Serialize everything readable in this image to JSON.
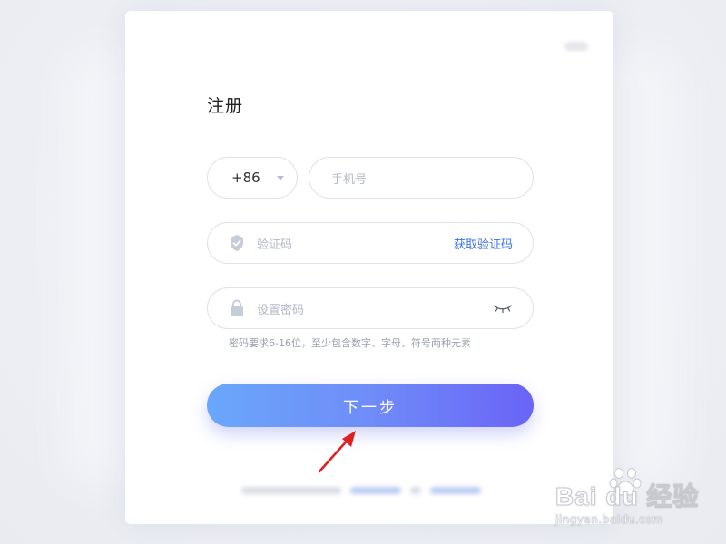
{
  "form": {
    "title": "注册",
    "country_code": "+86",
    "phone_placeholder": "手机号",
    "code_placeholder": "验证码",
    "get_code_label": "获取验证码",
    "password_placeholder": "设置密码",
    "password_hint": "密码要求6-16位，至少包含数字、字母、符号两种元素",
    "next_button_label": "下一步"
  },
  "icons": {
    "caret": "chevron-down-icon",
    "code": "shield-check-icon",
    "password": "lock-icon",
    "visibility": "eye-closed-icon",
    "annotation": "red-arrow-icon"
  },
  "colors": {
    "accent_link": "#3b74e6",
    "button_gradient_start": "#6aa7fb",
    "button_gradient_end": "#6a63f7",
    "annotation_arrow": "#e02020"
  },
  "watermark": {
    "brand": "Bai du 经验",
    "url": "jingyan.baidu.com"
  }
}
